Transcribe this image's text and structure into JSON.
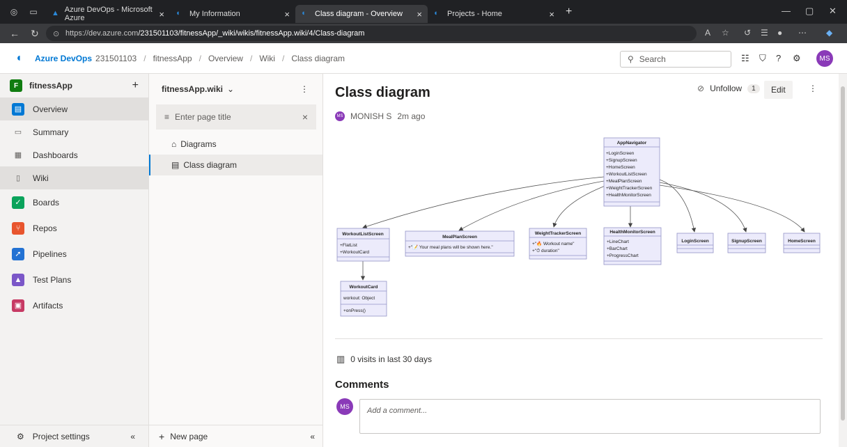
{
  "browser": {
    "tabs": [
      {
        "title": "Azure DevOps - Microsoft Azure",
        "close": "×"
      },
      {
        "title": "My Information",
        "close": "×"
      },
      {
        "title": "Class diagram - Overview",
        "close": "×"
      },
      {
        "title": "Projects - Home",
        "close": "×"
      }
    ],
    "new_tab": "+",
    "url_host": "https://dev.azure.com",
    "url_path": "/231501103/fitnessApp/_wiki/wikis/fitnessApp.wiki/4/Class-diagram",
    "minimize": "—",
    "maximize": "▢",
    "close": "✕"
  },
  "header": {
    "brand": "Azure DevOps",
    "org": "231501103",
    "breadcrumb": [
      "fitnessApp",
      "Overview",
      "Wiki",
      "Class diagram"
    ],
    "separator": "/",
    "search_placeholder": "Search",
    "avatar": "MS"
  },
  "sidebar": {
    "project": "fitnessApp",
    "project_initial": "F",
    "add": "+",
    "items": [
      {
        "label": "Overview",
        "color": "#0078d4"
      },
      {
        "label": "Summary",
        "color": "#605e5c"
      },
      {
        "label": "Dashboards",
        "color": "#605e5c"
      },
      {
        "label": "Wiki",
        "color": "#605e5c"
      },
      {
        "label": "Boards",
        "color": "#0aa35b"
      },
      {
        "label": "Repos",
        "color": "#e8552e"
      },
      {
        "label": "Pipelines",
        "color": "#2372d3"
      },
      {
        "label": "Test Plans",
        "color": "#7b57c8"
      },
      {
        "label": "Artifacts",
        "color": "#c73a64"
      }
    ],
    "settings": "Project settings",
    "collapse": "«"
  },
  "wiki_tree": {
    "name": "fitnessApp.wiki",
    "more": "⋮",
    "title_placeholder": "Enter page title",
    "clear": "×",
    "pages": [
      "Diagrams",
      "Class diagram"
    ],
    "new_page": "New page",
    "collapse": "«"
  },
  "page": {
    "title": "Class diagram",
    "unfollow": "Unfollow",
    "followers": "1",
    "edit": "Edit",
    "more": "⋮",
    "author": "MONISH S",
    "time": "2m ago",
    "author_initials": "MS",
    "visits": "0 visits in last 30 days",
    "comments_title": "Comments",
    "comment_placeholder": "Add a comment..."
  },
  "diagram": {
    "nodes": [
      {
        "name": "AppNavigator",
        "fields": [
          "+LoginScreen",
          "+SignupScreen",
          "+HomeScreen",
          "+WorkoutListScreen",
          "+MealPlanScreen",
          "+WeightTrackerScreen",
          "+HealthMonitorScreen"
        ]
      },
      {
        "name": "WorkoutListScreen",
        "fields": [
          "+FlatList",
          "+WorkoutCard"
        ]
      },
      {
        "name": "MealPlanScreen",
        "fields": [
          "+\"📝 Your meal plans will be shown here.\""
        ]
      },
      {
        "name": "WeightTrackerScreen",
        "fields": [
          "+\"🔥 Workout name\"",
          "+\"⏱ duration\""
        ]
      },
      {
        "name": "HealthMonitorScreen",
        "fields": [
          "+LineChart",
          "+BarChart",
          "+ProgressChart"
        ]
      },
      {
        "name": "LoginScreen",
        "fields": []
      },
      {
        "name": "SignupScreen",
        "fields": []
      },
      {
        "name": "HomeScreen",
        "fields": []
      },
      {
        "name": "WorkoutCard",
        "fields": [
          "workout: Object",
          "+onPress()"
        ]
      }
    ]
  }
}
